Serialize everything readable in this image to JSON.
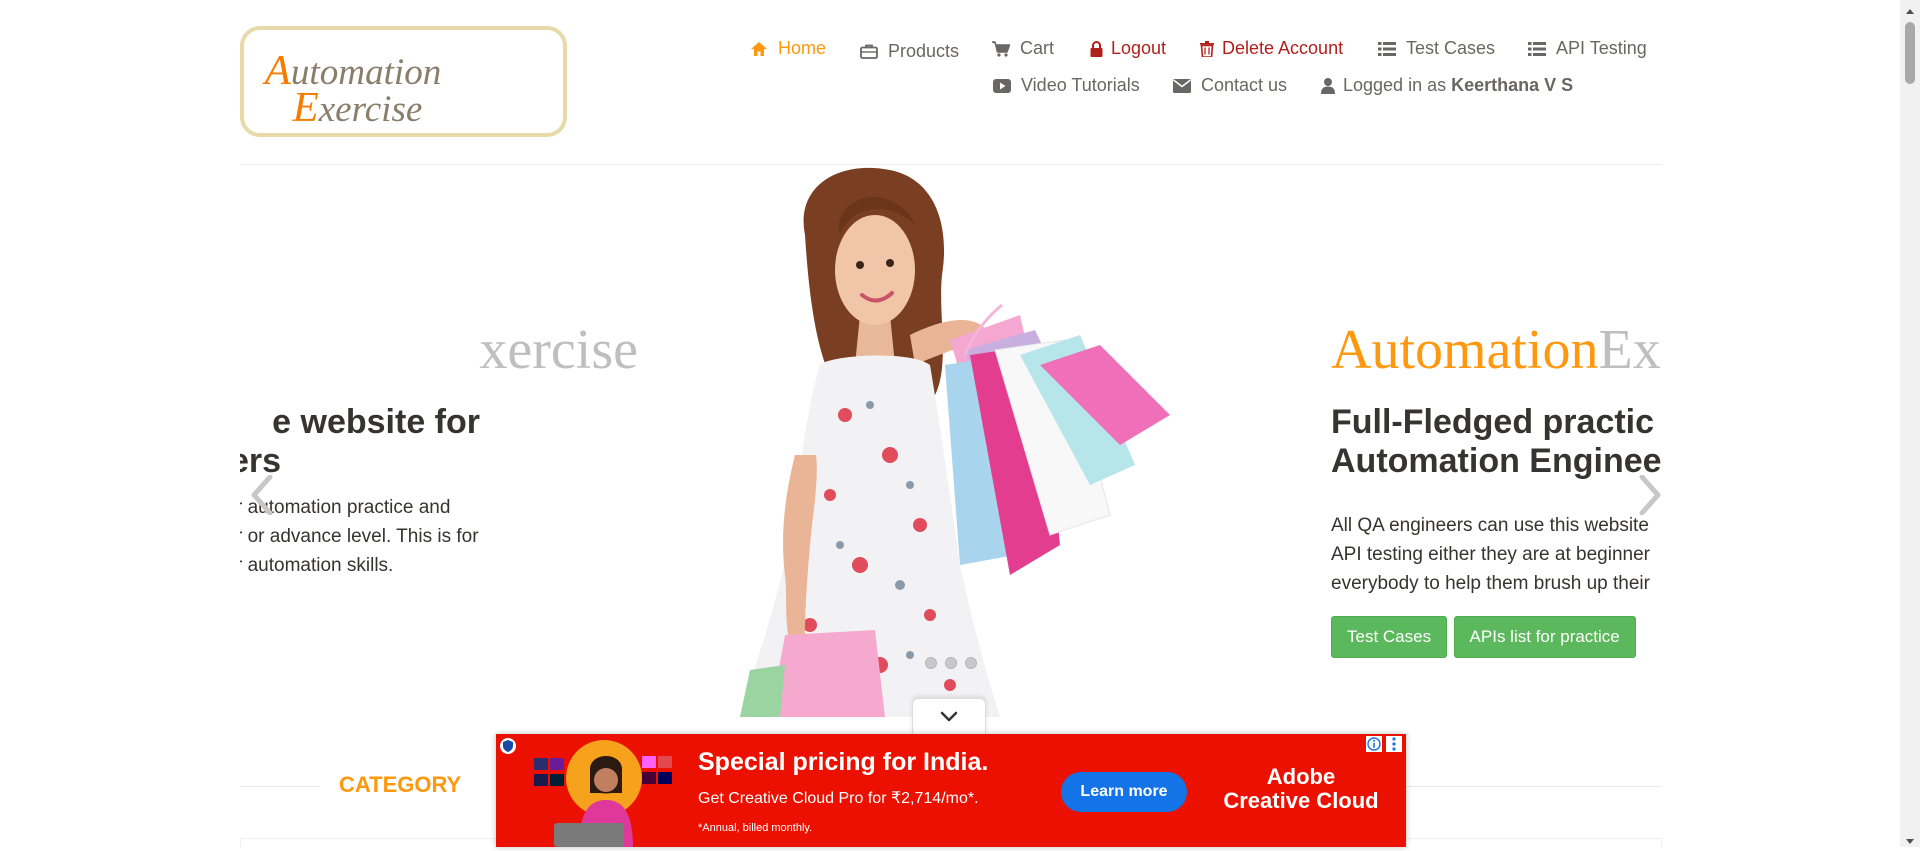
{
  "logo": {
    "line1": "Automation",
    "line2": "Exercise",
    "icon": "site-logo"
  },
  "nav": {
    "home": "Home",
    "products": "Products",
    "cart": "Cart",
    "logout": "Logout",
    "delete_account": "Delete Account",
    "test_cases": "Test Cases",
    "api_testing": "API Testing",
    "video_tutorials": "Video Tutorials",
    "contact_us": "Contact us",
    "logged_in_prefix": "Logged in as",
    "logged_in_user": "Keerthana V S"
  },
  "carousel": {
    "prev_slide": {
      "brand_b": "xercise",
      "heading_l1": "e website for",
      "heading_l2": "ers",
      "p_l1": "r automation practice and",
      "p_l2": "r or advance level. This is for",
      "p_l3": "r automation skills."
    },
    "next_slide": {
      "brand_a": "Automation",
      "brand_b": "Ex",
      "heading_l1": "Full-Fledged practic",
      "heading_l2": "Automation Enginee",
      "p_l1": "All QA engineers can use this website",
      "p_l2": "API testing either they are at beginner",
      "p_l3": "everybody to help them brush up their",
      "btn_test_cases": "Test Cases",
      "btn_apis": "APIs list for practice"
    },
    "active_dot": 0,
    "dot_count": 3
  },
  "section": {
    "category_title": "CATEGORY"
  },
  "ad": {
    "title": "Special pricing for India.",
    "subtitle": "Get Creative Cloud Pro for ₹2,714/mo*.",
    "note": "*Annual, billed monthly.",
    "cta": "Learn more",
    "brand_l1": "Adobe",
    "brand_l2": "Creative Cloud"
  },
  "colors": {
    "accent": "#FE980F",
    "text": "#696763",
    "danger": "#b0201d",
    "button_green": "#5cb85c",
    "ad_red": "#eb1000",
    "ad_blue": "#1473e6"
  }
}
